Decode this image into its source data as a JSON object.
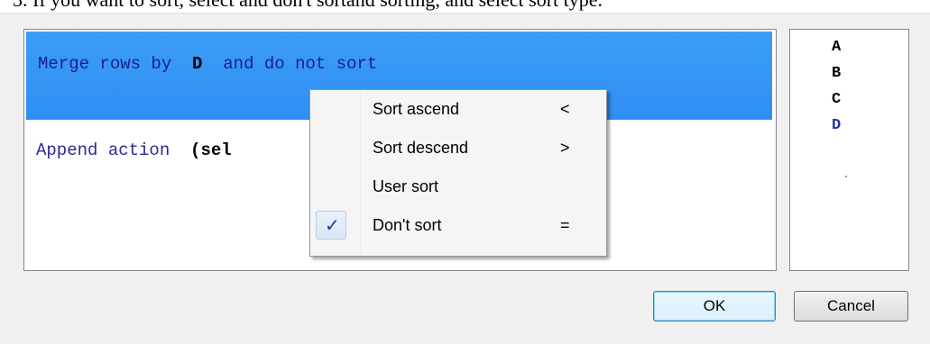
{
  "caption": "3.  If you want to sort, select and don't sortand sorting, and select sort type.",
  "main_panel": {
    "selected_row": {
      "prefix": "Merge rows by",
      "key": "D",
      "suffix": "and do not sort"
    },
    "row2": {
      "prefix": "Append action",
      "arg": "(sel"
    }
  },
  "side_panel": {
    "letters": [
      "A",
      "B",
      "C",
      "D"
    ],
    "active": "D"
  },
  "context_menu": {
    "items": [
      {
        "label": "Sort ascend",
        "shortcut": "<",
        "checked": false
      },
      {
        "label": "Sort descend",
        "shortcut": ">",
        "checked": false
      },
      {
        "label": "User sort",
        "shortcut": "",
        "checked": false
      },
      {
        "label": "Don't sort",
        "shortcut": "=",
        "checked": true
      }
    ],
    "check_glyph": "✓"
  },
  "buttons": {
    "ok": "OK",
    "cancel": "Cancel"
  },
  "colors": {
    "selection": "#3399ff",
    "keyword_text": "#1a1c8c",
    "accent_check": "#1a3fa0"
  }
}
